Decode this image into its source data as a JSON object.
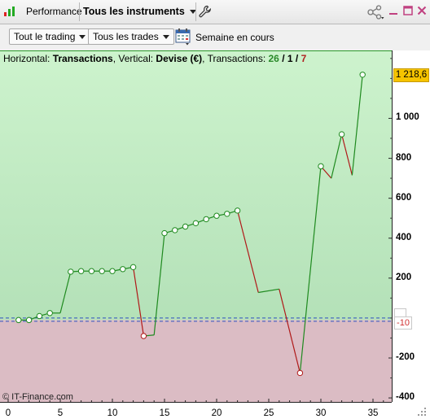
{
  "tabbar": {
    "performance_label": "Performance",
    "instruments_label": "Tous les instruments"
  },
  "toolbar": {
    "trading_dropdown": "Tout le trading",
    "trades_dropdown": "Tous les trades",
    "period_label": "Semaine en cours"
  },
  "chart": {
    "header_prefix": "Horizontal: ",
    "header_h": "Transactions",
    "header_mid": ", Vertical: ",
    "header_v": "Devise (€)",
    "header_mid2": ", Transactions: ",
    "count_win": "26",
    "slash1": " / ",
    "count_flat": "1",
    "slash2": " / ",
    "count_loss": "7",
    "last_value_badge": "1 218,6",
    "ref_value_badge": "-10",
    "watermark": "© IT-Finance.com",
    "colors": {
      "win_zone": "#c6f0c6",
      "loss_zone": "#dbbcc4",
      "win_line": "#1f8a1f",
      "loss_line": "#b01818",
      "badge": "#f6c400"
    }
  },
  "chart_data": {
    "type": "line",
    "title": "",
    "xlabel": "Transactions",
    "ylabel": "Devise (€)",
    "xlim": [
      0,
      36
    ],
    "ylim": [
      -420,
      1340
    ],
    "x_ticks": [
      "0",
      "5",
      "10",
      "15",
      "20",
      "25",
      "30",
      "35"
    ],
    "y_ticks": [
      {
        "value": 1000,
        "label": "1 000",
        "bold": true
      },
      {
        "value": 800,
        "label": "800",
        "bold": true
      },
      {
        "value": 600,
        "label": "600",
        "bold": true
      },
      {
        "value": 400,
        "label": "400",
        "bold": true
      },
      {
        "value": 200,
        "label": "200",
        "bold": true
      },
      {
        "value": -200,
        "label": "-200",
        "bold": true
      },
      {
        "value": -400,
        "label": "-400",
        "bold": true
      }
    ],
    "reference_value": -10,
    "points": [
      {
        "x": 1,
        "y": -10,
        "marker": true
      },
      {
        "x": 2,
        "y": -10,
        "marker": true
      },
      {
        "x": 3,
        "y": 10,
        "marker": true
      },
      {
        "x": 4,
        "y": 25,
        "marker": true
      },
      {
        "x": 5,
        "y": 25,
        "marker": false
      },
      {
        "x": 6,
        "y": 232,
        "marker": true
      },
      {
        "x": 7,
        "y": 235,
        "marker": true
      },
      {
        "x": 8,
        "y": 235,
        "marker": true
      },
      {
        "x": 9,
        "y": 235,
        "marker": true
      },
      {
        "x": 10,
        "y": 235,
        "marker": true
      },
      {
        "x": 11,
        "y": 245,
        "marker": true
      },
      {
        "x": 12,
        "y": 255,
        "marker": true
      },
      {
        "x": 13,
        "y": -90,
        "marker": true
      },
      {
        "x": 14,
        "y": -85,
        "marker": false
      },
      {
        "x": 15,
        "y": 425,
        "marker": true
      },
      {
        "x": 16,
        "y": 440,
        "marker": true
      },
      {
        "x": 17,
        "y": 458,
        "marker": true
      },
      {
        "x": 18,
        "y": 475,
        "marker": true
      },
      {
        "x": 19,
        "y": 495,
        "marker": true
      },
      {
        "x": 20,
        "y": 512,
        "marker": true
      },
      {
        "x": 21,
        "y": 522,
        "marker": true
      },
      {
        "x": 22,
        "y": 538,
        "marker": true
      },
      {
        "x": 24,
        "y": 128,
        "marker": false
      },
      {
        "x": 26,
        "y": 145,
        "marker": false
      },
      {
        "x": 28,
        "y": -275,
        "marker": true
      },
      {
        "x": 30,
        "y": 760,
        "marker": true
      },
      {
        "x": 31,
        "y": 700,
        "marker": false
      },
      {
        "x": 32,
        "y": 920,
        "marker": true
      },
      {
        "x": 33,
        "y": 715,
        "marker": false
      },
      {
        "x": 34,
        "y": 1218.6,
        "marker": true
      }
    ]
  }
}
